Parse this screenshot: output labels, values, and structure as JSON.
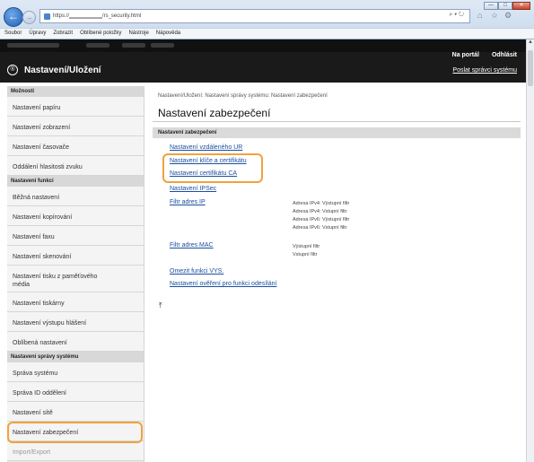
{
  "browser": {
    "url": "https://▁▁▁▁▁▁▁▁/rs_security.html",
    "addr_tools": "⌕ ▾ ↻",
    "window_buttons": [
      "—",
      "□",
      "✕"
    ],
    "right_icons": [
      "⌂",
      "☆",
      "⚙"
    ],
    "menu": [
      "Soubor",
      "Úpravy",
      "Zobrazit",
      "Oblíbené položky",
      "Nástroje",
      "Nápověda"
    ]
  },
  "header": {
    "logo": "®",
    "title": "Nastavení/Uložení",
    "portal_link": "Na portál",
    "logout_link": "Odhlásit",
    "mail_link": "Poslat správci systému"
  },
  "sidebar": {
    "groups": [
      {
        "title": "Možnosti",
        "items": [
          "Nastavení papíru",
          "Nastavení zobrazení",
          "Nastavení časovače",
          "Oddálení hlasitosti zvuku"
        ]
      },
      {
        "title": "Nastavení funkcí",
        "items": [
          "Běžná nastavení",
          "Nastavení kopírování",
          "Nastavení faxu",
          "Nastavení skenování",
          "Nastavení tisku z paměťového média",
          "Nastavení tiskárny",
          "Nastavení výstupu hlášení",
          "Oblíbená nastavení"
        ]
      },
      {
        "title": "Nastavení správy systému",
        "items": [
          "Správa systému",
          "Správa ID oddělení",
          "Nastavení sítě",
          "Nastavení zabezpečení",
          "Import/Export"
        ]
      }
    ]
  },
  "main": {
    "breadcrumb": "Nastavení/Uložení: Nastavení správy systému: Nastavení zabezpečení",
    "title": "Nastavení zabezpečení",
    "section_header": "Nastavení zabezpečení",
    "links": [
      "Nastavení vzdáleného UR",
      "Nastavení klíče a certifikátu",
      "Nastavení certifikátu CA",
      "Nastavení IPSec",
      "Filtr adres IP",
      "Filtr adres MAC",
      "Omezit funkci VYS.",
      "Nastavení ověření pro funkci odesílání"
    ],
    "ip_filter_details": [
      "Adresa IPv4: Výstupní filtr",
      "Adresa IPv4: Vstupní filtr",
      "Adresa IPv6: Výstupní filtr",
      "Adresa IPv6: Vstupní filtr"
    ],
    "mac_filter_details": [
      "Výstupní filtr",
      "Vstupní filtr"
    ],
    "top_icon": "⤒"
  },
  "colors": {
    "highlight": "#f0a23c",
    "link": "#1a4fa0",
    "header_bg": "#1a1a1a"
  }
}
